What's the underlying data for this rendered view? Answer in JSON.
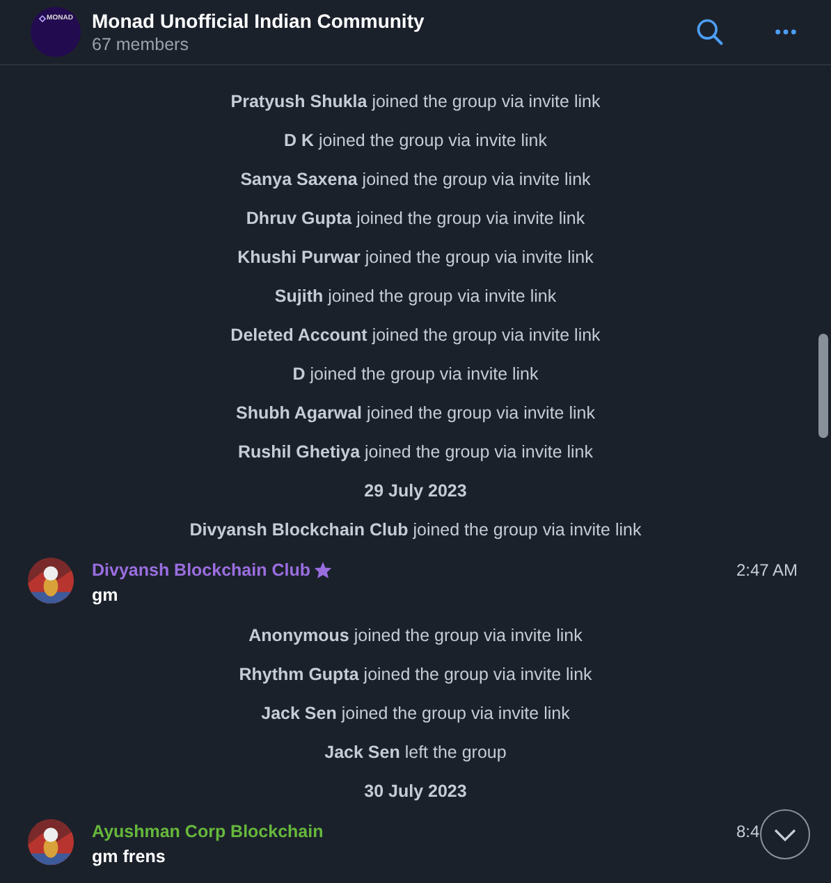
{
  "header": {
    "title": "Monad Unofficial Indian Community",
    "subtitle": "67 members",
    "avatar_text": "MONAD"
  },
  "feed": [
    {
      "kind": "service",
      "text": "**Pratyush Shukla** joined the group via invite link"
    },
    {
      "kind": "service",
      "text": "**D K** joined the group via invite link"
    },
    {
      "kind": "service",
      "text": "**Sanya Saxena** joined the group via invite link"
    },
    {
      "kind": "service",
      "text": "**Dhruv Gupta** joined the group via invite link"
    },
    {
      "kind": "service",
      "text": "**Khushi Purwar** joined the group via invite link"
    },
    {
      "kind": "service",
      "text": "**Sujith** joined the group via invite link"
    },
    {
      "kind": "service",
      "text": "**Deleted Account** joined the group via invite link"
    },
    {
      "kind": "service",
      "text": "**D** joined the group via invite link"
    },
    {
      "kind": "service",
      "text": "**Shubh Agarwal** joined the group via invite link"
    },
    {
      "kind": "service",
      "text": "**Rushil Ghetiya** joined the group via invite link"
    },
    {
      "kind": "date",
      "text": "29 July 2023"
    },
    {
      "kind": "service",
      "text": "**Divyansh Blockchain Club** joined the group via invite link"
    },
    {
      "kind": "message",
      "author": "Divyansh Blockchain Club",
      "color": "#9b6ee0",
      "premium": true,
      "text": "gm",
      "time": "2:47 AM"
    },
    {
      "kind": "service",
      "text": "**Anonymous** joined the group via invite link"
    },
    {
      "kind": "service",
      "text": "**Rhythm Gupta** joined the group via invite link"
    },
    {
      "kind": "service",
      "text": "**Jack Sen** joined the group via invite link"
    },
    {
      "kind": "service",
      "text": "**Jack Sen** left the group"
    },
    {
      "kind": "date",
      "text": "30 July 2023"
    },
    {
      "kind": "message",
      "author": "Ayushman Corp Blockchain",
      "color": "#66b83c",
      "premium": false,
      "text": "gm frens",
      "time": "8:4"
    }
  ]
}
